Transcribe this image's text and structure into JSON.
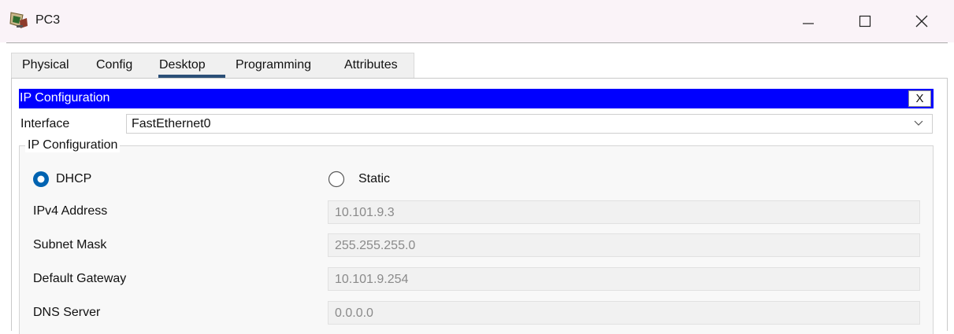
{
  "window": {
    "title": "PC3",
    "icon": "pc-device-icon",
    "controls": [
      "minimize-icon",
      "maximize-icon",
      "close-icon"
    ]
  },
  "tabs": [
    {
      "label": "Physical",
      "active": false
    },
    {
      "label": "Config",
      "active": false
    },
    {
      "label": "Desktop",
      "active": true
    },
    {
      "label": "Programming",
      "active": false
    },
    {
      "label": "Attributes",
      "active": false
    }
  ],
  "ip_config": {
    "title": "IP Configuration",
    "close_label": "X",
    "interface_label": "Interface",
    "interface_value": "FastEthernet0",
    "group_title": "IP Configuration",
    "mode": {
      "dhcp_label": "DHCP",
      "static_label": "Static",
      "selected": "DHCP"
    },
    "fields": [
      {
        "label": "IPv4 Address",
        "value": "10.101.9.3"
      },
      {
        "label": "Subnet Mask",
        "value": "255.255.255.0"
      },
      {
        "label": "Default Gateway",
        "value": "10.101.9.254"
      },
      {
        "label": "DNS Server",
        "value": "0.0.0.0"
      }
    ]
  },
  "colors": {
    "title_bar_bg": "#faf3f8",
    "header_bar": "#0000ff",
    "radio_selected": "#0063b1",
    "active_tab_underline": "#2b4f77",
    "disabled_text": "#8a8a8a"
  }
}
